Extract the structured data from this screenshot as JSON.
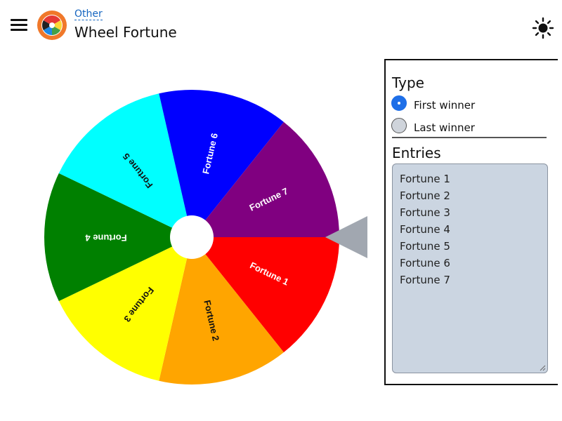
{
  "header": {
    "category": "Other",
    "title": "Wheel Fortune"
  },
  "icons": {
    "menu": "hamburger-menu-icon",
    "logo": "wheel-logo-icon",
    "theme": "sun-icon"
  },
  "wheel": {
    "segments": [
      {
        "label": "Fortune 1",
        "color": "#ff0000",
        "text_color": "#ffffff"
      },
      {
        "label": "Fortune 2",
        "color": "#ffa500",
        "text_color": "#111111"
      },
      {
        "label": "Fortune 3",
        "color": "#ffff00",
        "text_color": "#111111"
      },
      {
        "label": "Fortune 4",
        "color": "#008000",
        "text_color": "#ffffff"
      },
      {
        "label": "Fortune 5",
        "color": "#00ffff",
        "text_color": "#111111"
      },
      {
        "label": "Fortune 6",
        "color": "#0000ff",
        "text_color": "#ffffff"
      },
      {
        "label": "Fortune 7",
        "color": "#800080",
        "text_color": "#ffffff"
      }
    ],
    "pointer_color": "#a1a7b0"
  },
  "panel": {
    "type_title": "Type",
    "options": [
      {
        "label": "First winner",
        "checked": true
      },
      {
        "label": "Last winner",
        "checked": false
      }
    ],
    "entries_title": "Entries",
    "entries": [
      "Fortune 1",
      "Fortune 2",
      "Fortune 3",
      "Fortune 4",
      "Fortune 5",
      "Fortune 6",
      "Fortune 7"
    ]
  },
  "colors": {
    "accent": "#1e6fe8",
    "link": "#1565c0",
    "textarea_bg": "#cbd5e1"
  }
}
